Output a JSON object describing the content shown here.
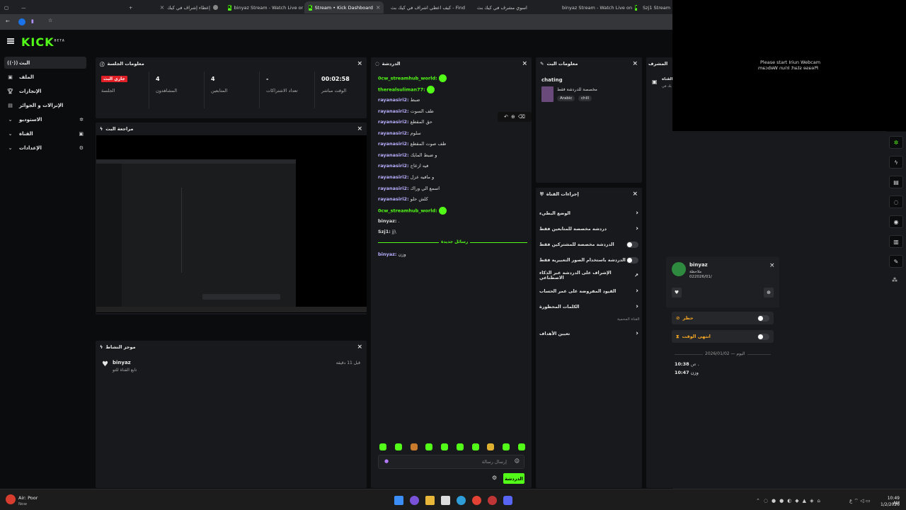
{
  "browser": {
    "tabs": [
      {
        "label": "",
        "active": false
      },
      {
        "label": "إعطاء إشراف في كيك",
        "active": false
      },
      {
        "label": "binyaz Stream - Watch Live on",
        "active": false
      },
      {
        "label": "Stream • Kick Dashboard",
        "active": true
      },
      {
        "label": "كيف اعطي اشراف في كيك بث - Find",
        "active": false
      },
      {
        "label": "اسوي مشرف في كيك بث",
        "active": false
      },
      {
        "label": "binyaz Stream - Watch Live on",
        "active": false
      },
      {
        "label": "Szj1 Stream",
        "active": false
      }
    ]
  },
  "logo": "KICK",
  "logo_badge": "BETA",
  "sidebar": {
    "items": [
      {
        "label": "البث",
        "icon": "broadcast-icon"
      },
      {
        "label": "الملف",
        "icon": "profile-icon"
      },
      {
        "label": "الإنجازات",
        "icon": "trophy-icon"
      },
      {
        "label": "الإنزالات و الجوائز",
        "icon": "gift-icon"
      },
      {
        "label": "الاستوديو",
        "icon": "studio-icon"
      },
      {
        "label": "القناة",
        "icon": "channel-icon"
      },
      {
        "label": "الإعدادات",
        "icon": "settings-icon"
      }
    ]
  },
  "session": {
    "title": "معلومات الجلسة",
    "live_badge": "جاري البث",
    "session_label": "الجلسة",
    "viewers_value": "4",
    "viewers_label": "المشاهدون",
    "followers_value": "4",
    "followers_label": "المتابعين",
    "subs_value": "-",
    "subs_label": "تعداد الاشتراكات",
    "time_value": "00:02:58",
    "time_label": "الوقت مباشر"
  },
  "preview": {
    "title": "مراجعة البث"
  },
  "activity": {
    "title": "موجز النشاط",
    "user": "binyaz",
    "action": "تابع القناة للتو",
    "time": "قبل 11 دقيقة"
  },
  "chat": {
    "title": "الدردشة",
    "messages": [
      {
        "user": "0cw_streamhub_world:",
        "text": "",
        "color": "g",
        "emote": true
      },
      {
        "user": "therealsuliman77:",
        "text": "",
        "color": "g",
        "emote": true
      },
      {
        "user": "rayanasiri2:",
        "text": "ضبط",
        "color": "p"
      },
      {
        "user": "rayanasiri2:",
        "text": "طف السوت",
        "color": "p"
      },
      {
        "user": "rayanasiri2:",
        "text": "حق المقطع",
        "color": "p"
      },
      {
        "user": "rayanasiri2:",
        "text": "سلوم",
        "color": "p"
      },
      {
        "user": "rayanasiri2:",
        "text": "طف صوت المقطع",
        "color": "p"
      },
      {
        "user": "rayanasiri2:",
        "text": "و ضبط المايك",
        "color": "p"
      },
      {
        "user": "rayanasiri2:",
        "text": "فيه ازعاج",
        "color": "p"
      },
      {
        "user": "rayanasiri2:",
        "text": "و مافيه عزل",
        "color": "p"
      },
      {
        "user": "rayanasiri2:",
        "text": "اسمع الي وراك",
        "color": "p"
      },
      {
        "user": "rayanasiri2:",
        "text": "كلش حلو",
        "color": "p"
      },
      {
        "user": "0cw_streamhub_world:",
        "text": "",
        "color": "g",
        "emote": true
      },
      {
        "user": "binyaz:",
        "text": ".",
        "color": "w"
      },
      {
        "user": "Szj1:",
        "text": "jj\\",
        "color": "w"
      }
    ],
    "new_messages": "رسائل جديدة",
    "after_message": {
      "user": "binyaz:",
      "text": "وزن"
    },
    "input_placeholder": "إرسال رسالة",
    "send_label": "الدردشة"
  },
  "stream_info": {
    "title": "معلومات البث",
    "stream_title": "chating",
    "category": "مخصصة للدردشة فقط",
    "tags": [
      "Arabic",
      "chill"
    ]
  },
  "channel_actions": {
    "title": "إجراءات القناة",
    "items": [
      {
        "label": "الوضع البطيء",
        "type": "arrow"
      },
      {
        "label": "دردشة مخصصة للمتابعين فقط",
        "type": "arrow"
      },
      {
        "label": "الدردشة مخصصة للمشتركين فقط",
        "type": "toggle"
      },
      {
        "label": "الدردشة باستخدام الصور التعبيرية فقط",
        "type": "toggle"
      },
      {
        "label": "الإشراف على الدردشة عبر الذكاء الاصطناعي",
        "type": "link"
      },
      {
        "label": "القيود المفروضة على عمر الحساب",
        "type": "arrow"
      },
      {
        "label": "الكلمات المحظورة",
        "type": "arrow"
      }
    ],
    "muted_label": "القناة المحمية",
    "goals_label": "تعيين الأهداف"
  },
  "moderator": {
    "title": "المشرف",
    "channel_label": "القناة",
    "subline": "مرحبًا بك في"
  },
  "webcam": {
    "line1": "Please start Iriun Webcam",
    "line2": "Please start Iriun Webcam"
  },
  "user_card": {
    "name": "binyaz",
    "role": "ملاحظة",
    "date": "022026/01/",
    "ban_label": "حظر",
    "timeout_label": "انتهى الوقت",
    "history_date": "2026/01/02",
    "history_today": "اليوم",
    "entry1_time": "10:38",
    "entry1_suffix": "ص",
    "entry1_text": ".",
    "entry2_time": "10:47",
    "entry2_text": "وزن"
  },
  "taskbar": {
    "weather_title": "Air: Poor",
    "weather_sub": "Now",
    "clock_time": "10:49 AM",
    "clock_date": "1/2/2026"
  }
}
